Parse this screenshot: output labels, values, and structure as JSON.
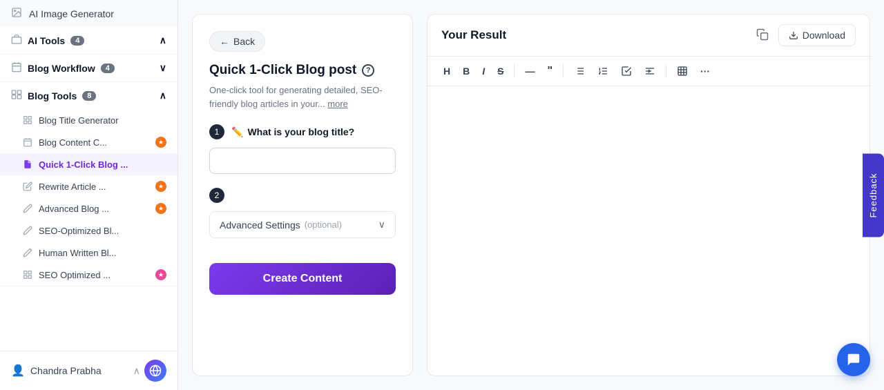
{
  "sidebar": {
    "ai_image_generator_label": "AI Image Generator",
    "ai_tools_label": "AI Tools",
    "ai_tools_badge": "4",
    "blog_workflow_label": "Blog Workflow",
    "blog_workflow_badge": "4",
    "blog_tools_label": "Blog Tools",
    "blog_tools_badge": "8",
    "items": [
      {
        "id": "blog-title-generator",
        "label": "Blog Title Generator",
        "icon": "grid",
        "badge": null
      },
      {
        "id": "blog-content-c",
        "label": "Blog Content C...",
        "icon": "calendar",
        "badge": "orange"
      },
      {
        "id": "quick-1-click",
        "label": "Quick 1-Click Blog ...",
        "icon": "file-blue",
        "badge": null,
        "active": true
      },
      {
        "id": "rewrite-article",
        "label": "Rewrite Article ...",
        "icon": "edit",
        "badge": "orange"
      },
      {
        "id": "advanced-blog",
        "label": "Advanced Blog ...",
        "icon": "edit2",
        "badge": "orange"
      },
      {
        "id": "seo-optimized",
        "label": "SEO-Optimized Bl...",
        "icon": "edit3",
        "badge": null
      },
      {
        "id": "human-written",
        "label": "Human Written Bl...",
        "icon": "pencil",
        "badge": null
      },
      {
        "id": "seo-optimized-2",
        "label": "SEO Optimized ...",
        "icon": "grid2",
        "badge": "pink"
      }
    ],
    "user_name": "Chandra Prabha"
  },
  "form": {
    "back_label": "Back",
    "title": "Quick 1-Click Blog post",
    "description": "One-click tool for generating detailed, SEO-friendly blog articles in your...",
    "more_label": "more",
    "step1_label": "What is your blog title?",
    "step1_placeholder": "",
    "step2_label": "Advanced Settings",
    "step2_optional": "(optional)",
    "create_button": "Create Content"
  },
  "result": {
    "title": "Your Result",
    "download_label": "Download",
    "toolbar": {
      "h": "H",
      "bold": "B",
      "italic": "I",
      "strikethrough": "S",
      "dash": "—",
      "quote": "❝",
      "bullet": "≡",
      "ordered": "≡",
      "check": "☑",
      "indent": "⇥",
      "table": "⊞",
      "more": "···"
    }
  },
  "feedback_label": "Feedback",
  "icons": {
    "back_arrow": "←",
    "chevron_down": "∨",
    "pencil": "✏",
    "info": "?",
    "copy": "⧉",
    "download_icon": "↓",
    "chat": "💬"
  }
}
